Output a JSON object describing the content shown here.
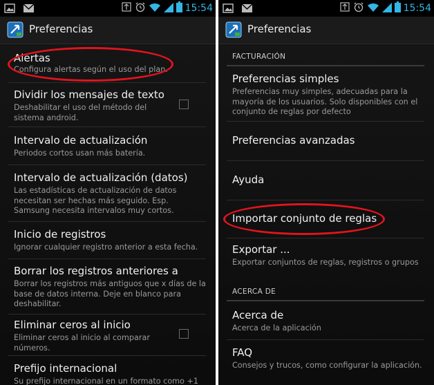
{
  "status": {
    "time": "15:54"
  },
  "left": {
    "title": "Preferencias",
    "items": [
      {
        "title": "Alertas",
        "summary": "Configura alertas según el uso del plan."
      },
      {
        "title": "Dividir los mensajes de texto en",
        "summary": "Deshabilitar el uso del método del sistema android."
      },
      {
        "title": "Intervalo de actualización",
        "summary": "Periodos cortos usan más batería."
      },
      {
        "title": "Intervalo de actualización (datos)",
        "summary": "Las estadísticas de actualización de datos necesitan ser hechas más seguido. Esp. Samsung necesita intervalos muy cortos."
      },
      {
        "title": "Inicio de registros",
        "summary": "Ignorar cualquier registro anterior a esta fecha."
      },
      {
        "title": "Borrar los registros anteriores a",
        "summary": "Borrar los registros más antiguos que x días de la base de datos interna. Deje en blanco para deshabilitar."
      },
      {
        "title": "Eliminar ceros al inicio",
        "summary": "Eliminar ceros al inicio al comparar números."
      },
      {
        "title": "Prefijo internacional",
        "summary": "Su prefijo internacional en un formato como +1"
      }
    ]
  },
  "right": {
    "title": "Preferencias",
    "cat_billing": "FACTURACIÓN",
    "cat_about": "ACERCA DE",
    "items": [
      {
        "title": "Preferencias simples",
        "summary": "Preferencias muy simples, adecuadas para la mayoría de los usuarios. Solo disponibles con el conjunto de reglas por defecto"
      },
      {
        "title": "Preferencias avanzadas"
      },
      {
        "title": "Ayuda"
      },
      {
        "title": "Importar conjunto de reglas"
      },
      {
        "title": "Exportar ...",
        "summary": "Exportar conjuntos de reglas, registros o grupos"
      },
      {
        "title": "Acerca de",
        "summary": "Acerca de la aplicación"
      },
      {
        "title": "FAQ",
        "summary": "Consejos y trucos, como configurar la aplicación."
      }
    ]
  },
  "colors": {
    "accent": "#33b5e5",
    "highlight": "#e0141e"
  },
  "icons": [
    "image-icon",
    "gmail-icon",
    "data-sync-icon",
    "alarm-icon",
    "wifi-icon",
    "signal-icon",
    "battery-icon",
    "app-icon",
    "checkbox-icon"
  ]
}
